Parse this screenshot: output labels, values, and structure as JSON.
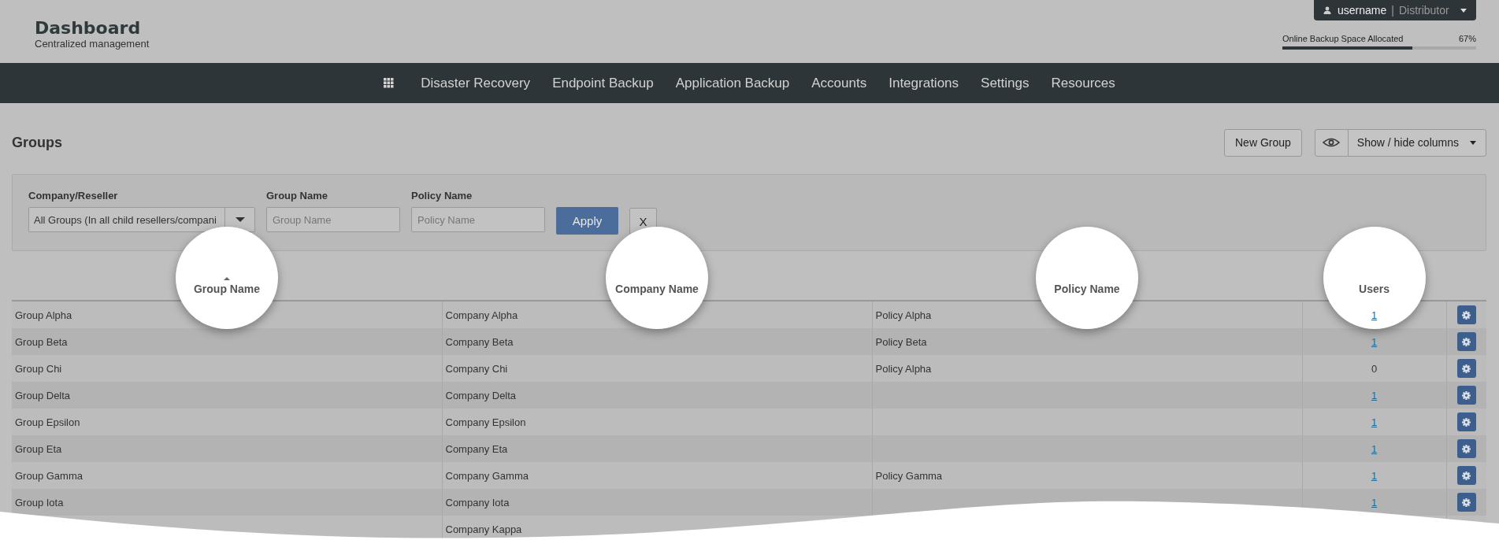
{
  "header": {
    "title": "Dashboard",
    "subtitle": "Centralized management"
  },
  "user_menu": {
    "username": "username",
    "separator": "|",
    "role": "Distributor"
  },
  "storage": {
    "label": "Online Backup Space Allocated",
    "reading": "67%",
    "level": 0.67
  },
  "nav": {
    "items": [
      "Disaster Recovery",
      "Endpoint Backup",
      "Application Backup",
      "Accounts",
      "Integrations",
      "Settings",
      "Resources"
    ]
  },
  "page": {
    "title": "Groups",
    "buttons": {
      "new": "New Group",
      "columns": "Show / hide columns"
    }
  },
  "filters": {
    "company": {
      "label": "Company/Reseller",
      "value": "All Groups (In all child resellers/compani"
    },
    "group": {
      "label": "Group Name",
      "placeholder": "Group Name"
    },
    "policy": {
      "label": "Policy Name",
      "placeholder": "Policy Name"
    },
    "apply": "Apply",
    "clear": "X"
  },
  "table": {
    "columns": [
      {
        "label": "Group Name",
        "sorted": true,
        "highlighted": true
      },
      {
        "label": "Company Name",
        "sorted": false,
        "highlighted": true
      },
      {
        "label": "Policy Name",
        "sorted": false,
        "highlighted": true
      },
      {
        "label": "Users",
        "sorted": false,
        "highlighted": true
      }
    ],
    "rows": [
      {
        "group": "Group Alpha",
        "company": "Company Alpha",
        "policy": "Policy Alpha",
        "users": "1",
        "users_link": true,
        "settings": true
      },
      {
        "group": "Group Beta",
        "company": "Company Beta",
        "policy": "Policy Beta",
        "users": "1",
        "users_link": true,
        "settings": true
      },
      {
        "group": "Group Chi",
        "company": "Company Chi",
        "policy": "Policy Alpha",
        "users": "0",
        "users_link": false,
        "settings": true
      },
      {
        "group": "Group Delta",
        "company": "Company Delta",
        "users": "1",
        "users_link": true,
        "settings": true
      },
      {
        "group": "Group Epsilon",
        "company": "Company Epsilon",
        "users": "1",
        "users_link": true,
        "settings": true
      },
      {
        "group": "Group Eta",
        "company": "Company Eta",
        "users": "1",
        "users_link": true,
        "settings": true
      },
      {
        "group": "Group Gamma",
        "company": "Company Gamma",
        "policy": "Policy Gamma",
        "users": "1",
        "users_link": true,
        "settings": true
      },
      {
        "group": "Group Iota",
        "company": "Company Iota",
        "users": "1",
        "users_link": true,
        "settings": true
      },
      {
        "company": "Company Kappa"
      }
    ]
  }
}
